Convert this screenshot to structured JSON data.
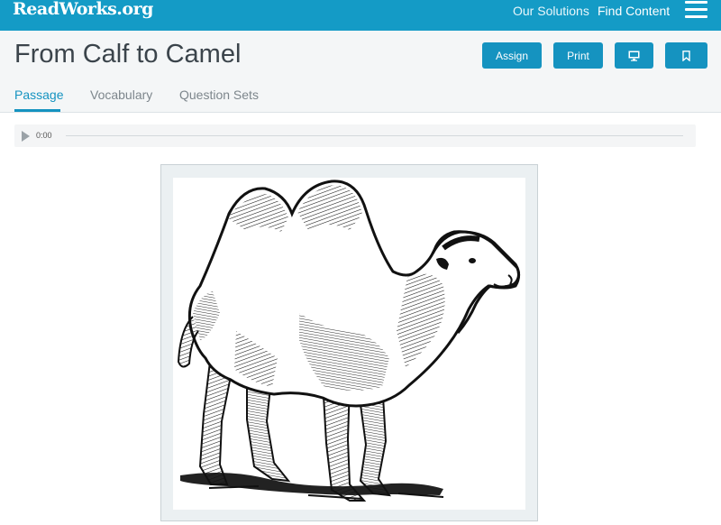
{
  "nav": {
    "logo": "ReadWorks.org",
    "our_solutions": "Our Solutions",
    "find_content": "Find Content",
    "menu_icon": "hamburger-menu-icon"
  },
  "header": {
    "title": "From Calf to Camel",
    "buttons": {
      "assign": "Assign",
      "print": "Print",
      "present_icon": "monitor-icon",
      "bookmark_icon": "bookmark-icon"
    },
    "tabs": [
      "Passage",
      "Vocabulary",
      "Question Sets"
    ],
    "active_tab": "Passage"
  },
  "audio": {
    "time": "0:00",
    "play_icon": "play-icon",
    "progress": 0
  },
  "figure": {
    "subject": "camel-illustration"
  },
  "colors": {
    "brand": "#149bc6",
    "button": "#1593c0",
    "header_bg": "#f4f6f7"
  }
}
